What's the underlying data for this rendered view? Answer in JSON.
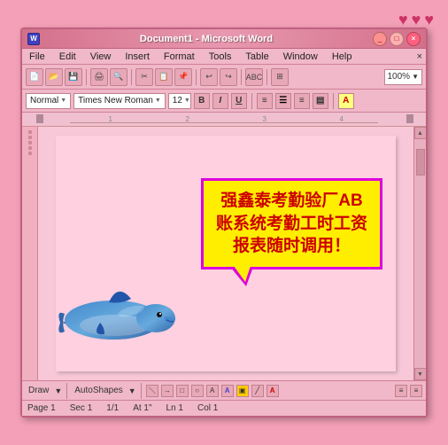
{
  "window": {
    "title": "Document1 - Microsoft Word",
    "app": "Word"
  },
  "hearts": [
    "♥",
    "♥",
    "♥"
  ],
  "titlebar": {
    "close": "×",
    "minimize": "−",
    "maximize": "□"
  },
  "menubar": {
    "items": [
      "File",
      "Edit",
      "View",
      "Insert",
      "Format",
      "Tools",
      "Table",
      "Window",
      "Help"
    ]
  },
  "toolbar": {
    "zoom": "100%"
  },
  "formatbar": {
    "style": "Normal",
    "font": "Times New Roman",
    "size": "12",
    "bold": "B",
    "italic": "I",
    "underline": "U"
  },
  "document": {
    "content": "强鑫泰考勤验厂AB账系统考勤工时工资报表随时调用！"
  },
  "statusbar": {
    "page": "Page 1",
    "sec": "Sec 1",
    "position": "1/1",
    "at": "At 1\"",
    "ln": "Ln 1",
    "col": "Col 1"
  },
  "draw": {
    "label": "Draw",
    "autoshapes": "AutoShapes"
  }
}
